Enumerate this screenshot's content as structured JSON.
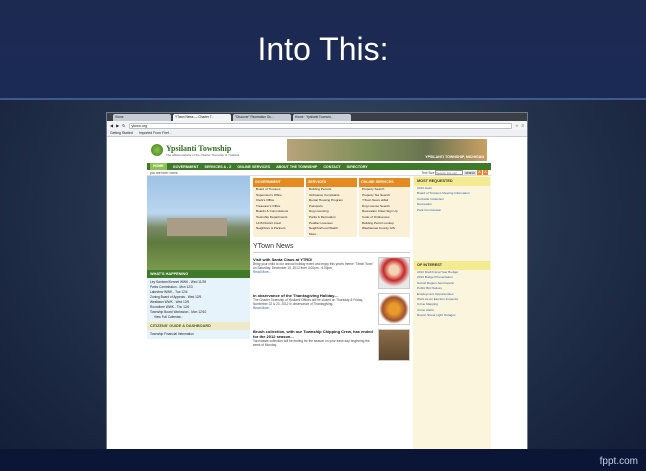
{
  "slide": {
    "title": "Into This:",
    "watermark": "fppt.com"
  },
  "browser": {
    "tabs": [
      "Home",
      "YTown News — Charter T...",
      "\"Discover\" Recreation Gu...",
      "Home · Ypsilanti Townshi..."
    ],
    "url": "ytown.org",
    "bookmarks": [
      "Getting Started",
      "Imported From Firef..."
    ]
  },
  "site": {
    "name": "Ypsilanti Township",
    "tagline": "The official website of the Charter Township of Ypsilanti",
    "banner_text": "YPSILANTI TOWNSHIP, MICHIGAN",
    "nav": [
      "HOME",
      "GOVERNMENT",
      "SERVICES A - Z",
      "ONLINE SERVICES",
      "ABOUT THE TOWNSHIP",
      "CONTACT",
      "DIRECTORY"
    ],
    "breadcrumb": "you are here: home",
    "text_size_label": "Text Size",
    "search_placeholder": "Search this site",
    "search_button": "search",
    "whats_happening": {
      "title": "WHAT'S HAPPENING",
      "items": [
        "Ley Sanborn/Kennet WWK - Wed 11/28",
        "Parks Commission - Mon 12/3",
        "Lakeview WWK - Tue 12/4",
        "Zoning Board of Appeals - Wed 12/5",
        "Westlawn WWK - Wed 12/5",
        "Roundtree WWK - Thu 12/6",
        "Township Board Workssion - Mon 12/10"
      ],
      "more": "View Full Calendar..."
    },
    "citizens_guide": {
      "title": "CITIZENS' GUIDE & DASHBOARD",
      "item": "Township Financial Information"
    },
    "government": {
      "title": "GOVERNMENT",
      "items": [
        "Board of Trustees",
        "Supervisor's Office",
        "Clerk's Office",
        "Treasurer's Office",
        "Boards & Commissions",
        "Township Departments",
        "14-B District Court",
        "Neighbors & Partners"
      ]
    },
    "services": {
      "title": "SERVICES",
      "items": [
        "Building Permits",
        "Ordinance Complaints",
        "Rental Housing Program",
        "Passports",
        "Dog Licensing",
        "Parks & Recreation",
        "Peddler Licenses",
        "Neighborhood Watch",
        "More..."
      ]
    },
    "online_services": {
      "title": "ONLINE SERVICES",
      "items": [
        "Property Search",
        "Property Tax Search",
        "YTown News eMail",
        "Dog License Search",
        "Recreation Class Sign Up",
        "Code of Ordinances",
        "Building Permit Lookup",
        "Washtenaw County GIS"
      ]
    },
    "most_requested": {
      "title": "MOST REQUESTED",
      "items": [
        "2013 Audit",
        "Board of Trustees Meeting Information",
        "Curbside Collection",
        "Recreation",
        "Park Commission"
      ]
    },
    "of_interest": {
      "title": "OF INTEREST",
      "items": [
        "2013 Draft Fiscal Year Budget",
        "2013 Budget Presentation",
        "Detroit Region Aerotropolis",
        "Public Bid Notices",
        "Employment Opportunities",
        "Work As An Election Inspector",
        "Crime Mapping",
        "Crime Alerts",
        "Report Street Light Outages"
      ]
    },
    "news_heading": "YTown News",
    "news": [
      {
        "title": "Visit with Santa Claus at YTRD!",
        "body": "Bring your child to our annual holiday event and enjoy this year's theme \"Tinsel Town\" on Saturday, December 15, 2012 from 4:00pm - 6:00pm.",
        "more": "Read More..."
      },
      {
        "title": "In observance of the Thanksgiving Holiday....",
        "body": "The Charter Township of Ypsilanti Offices will be closed on Thursday & Friday, November 22 & 23, 2012 in observance of Thanksgiving.",
        "more": "Read More..."
      },
      {
        "title": "Brush collection, with our Township Chipping Crew, has ended for the 2012 season...",
        "body": "Yard waste collection will be ending for the season on your trash day beginning the week of Monday.",
        "more": ""
      }
    ]
  }
}
